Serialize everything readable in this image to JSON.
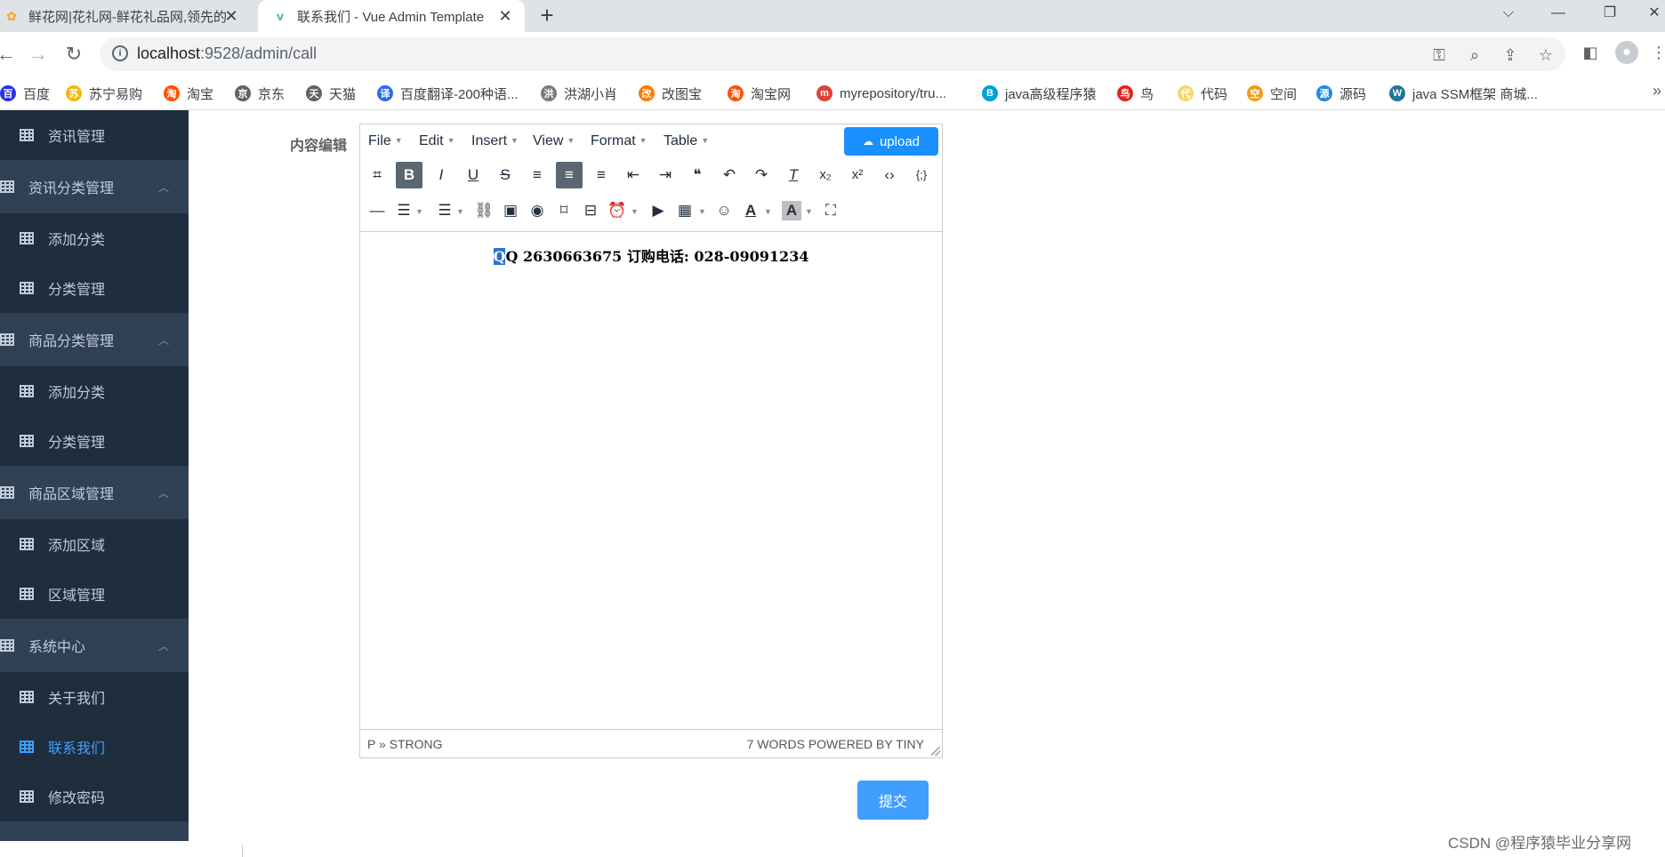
{
  "browser": {
    "tabs": [
      {
        "title": "鲜花网|花礼网-鲜花礼品网,领先的",
        "close": "✕"
      },
      {
        "title": "联系我们 - Vue Admin Template",
        "close": "✕"
      }
    ],
    "new_tab": "+",
    "window_controls": {
      "dropdown": "⌵",
      "minimize": "—",
      "restore": "❐",
      "close": "✕"
    },
    "nav": {
      "back": "←",
      "forward": "→",
      "reload": "↻"
    },
    "url_host": "localhost",
    "url_rest": ":9528/admin/call",
    "info_icon": "i",
    "omnibox_icons": {
      "key": "⚿",
      "zoom": "⌕",
      "share": "⇪",
      "star": "☆"
    },
    "sidepanel_icon": "◧",
    "profile_icon": "●",
    "menu_icon": "⋮",
    "bookmarks_more": "»",
    "bookmarks": [
      {
        "label": "百度",
        "color": "#2932e1",
        "glyph": "百"
      },
      {
        "label": "苏宁易购",
        "color": "#f7b500",
        "glyph": "苏"
      },
      {
        "label": "淘宝",
        "color": "#ff5000",
        "glyph": "淘"
      },
      {
        "label": "京东",
        "color": "#5f6368",
        "glyph": "京"
      },
      {
        "label": "天猫",
        "color": "#5f6368",
        "glyph": "天"
      },
      {
        "label": "百度翻译-200种语...",
        "color": "#2b6bf3",
        "glyph": "译"
      },
      {
        "label": "洪湖小肖",
        "color": "#7a7a7a",
        "glyph": "洪"
      },
      {
        "label": "改图宝",
        "color": "#ff7a00",
        "glyph": "改"
      },
      {
        "label": "淘宝网",
        "color": "#ff5000",
        "glyph": "淘"
      },
      {
        "label": "myrepository/tru...",
        "color": "#db4437",
        "glyph": "m"
      },
      {
        "label": "java高级程序猿",
        "color": "#00a1d6",
        "glyph": "B"
      },
      {
        "label": "鸟",
        "color": "#e1251b",
        "glyph": "鸟"
      },
      {
        "label": "代码",
        "color": "#f5d76e",
        "glyph": "代"
      },
      {
        "label": "空间",
        "color": "#f39c12",
        "glyph": "空"
      },
      {
        "label": "源码",
        "color": "#1e88e5",
        "glyph": "源"
      },
      {
        "label": "java SSM框架 商城...",
        "color": "#21759b",
        "glyph": "W"
      }
    ]
  },
  "sidebar": {
    "items": [
      {
        "label": "资讯管理",
        "type": "sub",
        "active": false
      },
      {
        "label": "资讯分类管理",
        "type": "head",
        "chevron": "︿"
      },
      {
        "label": "添加分类",
        "type": "sub",
        "active": false
      },
      {
        "label": "分类管理",
        "type": "sub",
        "active": false
      },
      {
        "label": "商品分类管理",
        "type": "head",
        "chevron": "︿"
      },
      {
        "label": "添加分类",
        "type": "sub",
        "active": false
      },
      {
        "label": "分类管理",
        "type": "sub",
        "active": false
      },
      {
        "label": "商品区域管理",
        "type": "head",
        "chevron": "︿"
      },
      {
        "label": "添加区域",
        "type": "sub",
        "active": false
      },
      {
        "label": "区域管理",
        "type": "sub",
        "active": false
      },
      {
        "label": "系统中心",
        "type": "head",
        "chevron": "︿"
      },
      {
        "label": "关于我们",
        "type": "sub",
        "active": false
      },
      {
        "label": "联系我们",
        "type": "sub",
        "active": true
      },
      {
        "label": "修改密码",
        "type": "sub",
        "active": false
      }
    ]
  },
  "form": {
    "label": "内容编辑",
    "submit": "提交"
  },
  "editor": {
    "menus": [
      "File",
      "Edit",
      "Insert",
      "View",
      "Format",
      "Table"
    ],
    "upload_label": "upload",
    "toolbar_row1": [
      {
        "icon": "find-replace-icon",
        "glyph": "⌗",
        "on": false
      },
      {
        "icon": "bold-icon",
        "glyph": "B",
        "on": true
      },
      {
        "icon": "italic-icon",
        "glyph": "I",
        "on": false
      },
      {
        "icon": "underline-icon",
        "glyph": "U",
        "on": false
      },
      {
        "icon": "strikethrough-icon",
        "glyph": "S",
        "on": false
      },
      {
        "icon": "align-left-icon",
        "glyph": "≡",
        "on": false
      },
      {
        "icon": "align-center-icon",
        "glyph": "≡",
        "on": true
      },
      {
        "icon": "align-right-icon",
        "glyph": "≡",
        "on": false
      },
      {
        "icon": "outdent-icon",
        "glyph": "⇤",
        "on": false
      },
      {
        "icon": "indent-icon",
        "glyph": "⇥",
        "on": false
      },
      {
        "icon": "blockquote-icon",
        "glyph": "❝",
        "on": false
      },
      {
        "icon": "undo-icon",
        "glyph": "↶",
        "on": false
      },
      {
        "icon": "redo-icon",
        "glyph": "↷",
        "on": false
      },
      {
        "icon": "remove-format-icon",
        "glyph": "T",
        "on": false
      },
      {
        "icon": "subscript-icon",
        "glyph": "x₂",
        "on": false
      },
      {
        "icon": "superscript-icon",
        "glyph": "x²",
        "on": false
      },
      {
        "icon": "code-icon",
        "glyph": "‹›",
        "on": false
      },
      {
        "icon": "code-sample-icon",
        "glyph": "{;}",
        "on": false
      }
    ],
    "toolbar_row2": [
      {
        "icon": "horizontal-rule-icon",
        "glyph": "—"
      },
      {
        "icon": "bullet-list-icon",
        "glyph": "☰"
      },
      {
        "icon": "numbered-list-icon",
        "glyph": "☰"
      },
      {
        "icon": "link-icon",
        "glyph": "⛓"
      },
      {
        "icon": "image-icon",
        "glyph": "▣"
      },
      {
        "icon": "preview-icon",
        "glyph": "◉"
      },
      {
        "icon": "anchor-icon",
        "glyph": "⌑"
      },
      {
        "icon": "page-break-icon",
        "glyph": "⊟"
      },
      {
        "icon": "insert-datetime-icon",
        "glyph": "⏰"
      },
      {
        "icon": "media-icon",
        "glyph": "▶"
      },
      {
        "icon": "table-icon",
        "glyph": "▦"
      },
      {
        "icon": "emoticons-icon",
        "glyph": "☺"
      },
      {
        "icon": "text-color-icon",
        "glyph": "A"
      },
      {
        "icon": "background-color-icon",
        "glyph": "A"
      },
      {
        "icon": "fullscreen-icon",
        "glyph": "⛶"
      }
    ],
    "content_first_char": "Q",
    "content_rest": "Q  2630663675  订购电话: 028-09091234",
    "status_path": "P » STRONG",
    "status_right": "7 WORDS POWERED BY TINY"
  },
  "watermark": "CSDN @程序猿毕业分享网"
}
